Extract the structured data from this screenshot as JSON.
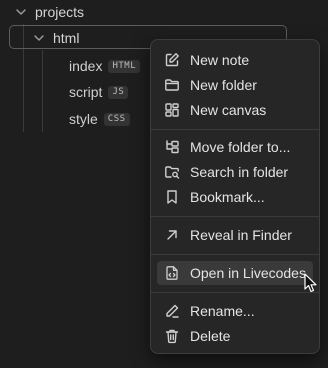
{
  "tree": {
    "root_folder": "projects",
    "folder": "html",
    "files": [
      {
        "name": "index",
        "tag": "HTML"
      },
      {
        "name": "script",
        "tag": "JS"
      },
      {
        "name": "style",
        "tag": "CSS"
      }
    ]
  },
  "context_menu": {
    "items": [
      {
        "label": "New note",
        "icon": "edit-note-icon"
      },
      {
        "label": "New folder",
        "icon": "folder-icon"
      },
      {
        "label": "New canvas",
        "icon": "canvas-grid-icon"
      },
      {
        "label": "Move folder to...",
        "icon": "move-folder-icon"
      },
      {
        "label": "Search in folder",
        "icon": "folder-search-icon"
      },
      {
        "label": "Bookmark...",
        "icon": "bookmark-icon"
      },
      {
        "label": "Reveal in Finder",
        "icon": "reveal-arrow-icon"
      },
      {
        "label": "Open in Livecodes",
        "icon": "code-file-icon",
        "highlighted": true
      },
      {
        "label": "Rename...",
        "icon": "pencil-icon"
      },
      {
        "label": "Delete",
        "icon": "trash-icon"
      }
    ]
  }
}
